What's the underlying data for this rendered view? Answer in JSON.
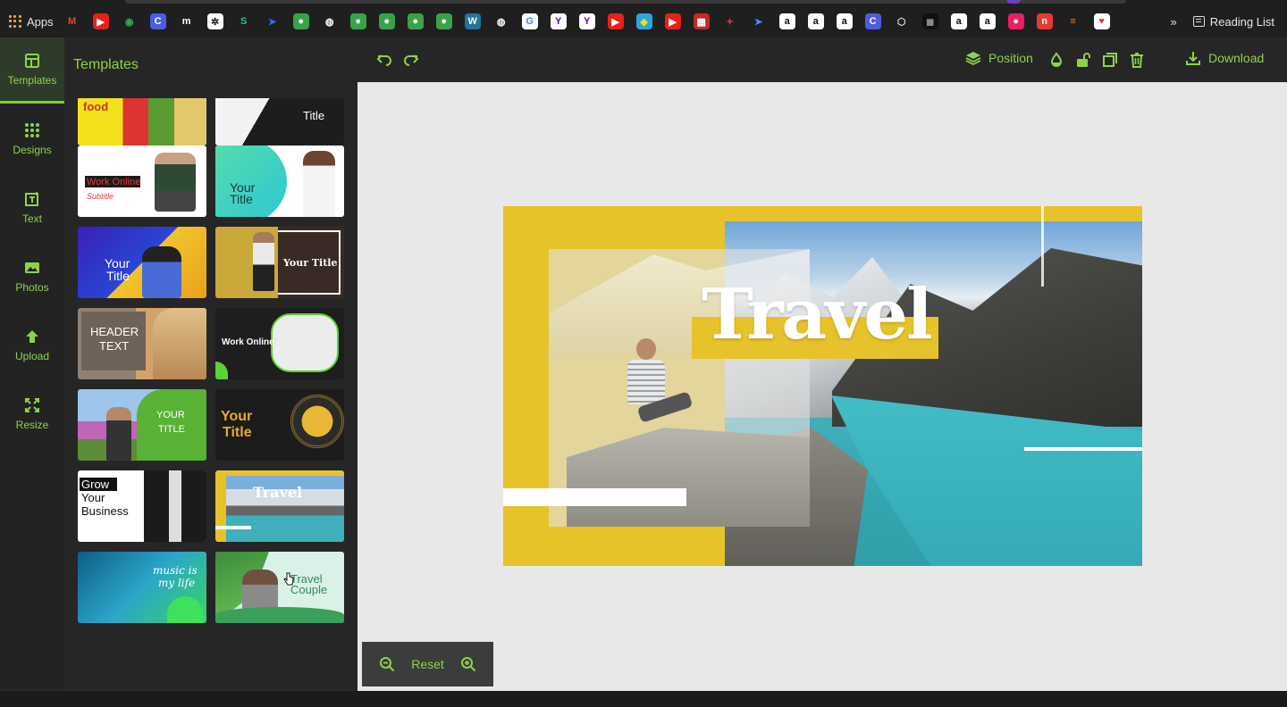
{
  "browser": {
    "apps_label": "Apps",
    "reading_list_label": "Reading List",
    "overflow_label": "»",
    "bookmarks": [
      {
        "name": "gmail-icon",
        "color": "#1f1f1f",
        "fg": "#ea4335",
        "glyph": "M"
      },
      {
        "name": "youtube-icon",
        "color": "#e62117",
        "fg": "#fff",
        "glyph": "▶"
      },
      {
        "name": "maps-icon",
        "color": "#1f1f1f",
        "fg": "#34a853",
        "glyph": "◉"
      },
      {
        "name": "c-icon",
        "color": "#4a5ce0",
        "fg": "#fff",
        "glyph": "C"
      },
      {
        "name": "m-icon",
        "color": "#1f1f1f",
        "fg": "#fff",
        "glyph": "m"
      },
      {
        "name": "openai-icon",
        "color": "#fff",
        "fg": "#111",
        "glyph": "✲"
      },
      {
        "name": "green-s-icon",
        "color": "#1f1f1f",
        "fg": "#19c39c",
        "glyph": "S"
      },
      {
        "name": "arrow-icon",
        "color": "#1f1f1f",
        "fg": "#3b6cff",
        "glyph": "➤"
      },
      {
        "name": "leaf-icon",
        "color": "#3aa14a",
        "fg": "#fff",
        "glyph": "●"
      },
      {
        "name": "globe-icon",
        "color": "#1f1f1f",
        "fg": "#fff",
        "glyph": "◍"
      },
      {
        "name": "leaf-icon",
        "color": "#3aa14a",
        "fg": "#fff",
        "glyph": "●"
      },
      {
        "name": "leaf-icon",
        "color": "#3aa14a",
        "fg": "#fff",
        "glyph": "●"
      },
      {
        "name": "leaf-icon",
        "color": "#3aa14a",
        "fg": "#fff",
        "glyph": "●"
      },
      {
        "name": "leaf-icon",
        "color": "#3aa14a",
        "fg": "#fff",
        "glyph": "●"
      },
      {
        "name": "wordpress-icon",
        "color": "#21759b",
        "fg": "#fff",
        "glyph": "W"
      },
      {
        "name": "globe-icon",
        "color": "#1f1f1f",
        "fg": "#fff",
        "glyph": "◍"
      },
      {
        "name": "google-icon",
        "color": "#fff",
        "fg": "#4285f4",
        "glyph": "G"
      },
      {
        "name": "yahoo-icon",
        "color": "#fff",
        "fg": "#5f01d1",
        "glyph": "Y"
      },
      {
        "name": "yahoo-icon",
        "color": "#fff",
        "fg": "#5f01d1",
        "glyph": "Y"
      },
      {
        "name": "youtube-icon",
        "color": "#e62117",
        "fg": "#fff",
        "glyph": "▶"
      },
      {
        "name": "colorful-icon",
        "color": "#2aa6e0",
        "fg": "#ffdd00",
        "glyph": "◆"
      },
      {
        "name": "youtube-icon",
        "color": "#e62117",
        "fg": "#fff",
        "glyph": "▶"
      },
      {
        "name": "red-grid-icon",
        "color": "#c62828",
        "fg": "#fff",
        "glyph": "▦"
      },
      {
        "name": "red-star-icon",
        "color": "#1f1f1f",
        "fg": "#d32f2f",
        "glyph": "✦"
      },
      {
        "name": "send-icon",
        "color": "#1f1f1f",
        "fg": "#4a8cff",
        "glyph": "➤"
      },
      {
        "name": "amazon-icon",
        "color": "#fff",
        "fg": "#111",
        "glyph": "a"
      },
      {
        "name": "amazon-icon",
        "color": "#fff",
        "fg": "#111",
        "glyph": "a"
      },
      {
        "name": "amazon-icon",
        "color": "#fff",
        "fg": "#111",
        "glyph": "a"
      },
      {
        "name": "c-icon",
        "color": "#4a5ce0",
        "fg": "#fff",
        "glyph": "C"
      },
      {
        "name": "cube-icon",
        "color": "#1f1f1f",
        "fg": "#ddd",
        "glyph": "⬡"
      },
      {
        "name": "dark-icon",
        "color": "#111",
        "fg": "#888",
        "glyph": "◼"
      },
      {
        "name": "amazon-icon",
        "color": "#fff",
        "fg": "#111",
        "glyph": "a"
      },
      {
        "name": "amazon-icon",
        "color": "#fff",
        "fg": "#111",
        "glyph": "a"
      },
      {
        "name": "pink-icon",
        "color": "#e91e63",
        "fg": "#fff",
        "glyph": "●"
      },
      {
        "name": "n-icon",
        "color": "#e53935",
        "fg": "#fff",
        "glyph": "n"
      },
      {
        "name": "stack-icon",
        "color": "#1f1f1f",
        "fg": "#f48024",
        "glyph": "≡"
      },
      {
        "name": "heart-icon",
        "color": "#fff",
        "fg": "#e53935",
        "glyph": "♥"
      }
    ]
  },
  "nav": {
    "items": [
      {
        "label": "Templates",
        "icon": "templates-icon",
        "active": true
      },
      {
        "label": "Designs",
        "icon": "designs-grid-icon",
        "active": false
      },
      {
        "label": "Text",
        "icon": "text-icon",
        "active": false
      },
      {
        "label": "Photos",
        "icon": "photo-icon",
        "active": false
      },
      {
        "label": "Upload",
        "icon": "upload-icon",
        "active": false
      },
      {
        "label": "Resize",
        "icon": "resize-icon",
        "active": false
      }
    ]
  },
  "panel": {
    "title": "Templates",
    "templates": [
      {
        "id": "food",
        "texts": [
          "food"
        ]
      },
      {
        "id": "title-dark",
        "texts": [
          "Title"
        ]
      },
      {
        "id": "work-online-white",
        "texts": [
          "Work Online",
          "Subtitle"
        ]
      },
      {
        "id": "your-title-teal",
        "texts": [
          "Your",
          "Title"
        ]
      },
      {
        "id": "your-title-vr",
        "texts": [
          "Your",
          "Title"
        ]
      },
      {
        "id": "your-title-olive",
        "texts": [
          "Your Title"
        ]
      },
      {
        "id": "header-text",
        "texts": [
          "HEADER",
          "TEXT"
        ]
      },
      {
        "id": "work-online-dark",
        "texts": [
          "Work Online"
        ]
      },
      {
        "id": "your-title-green",
        "texts": [
          "YOUR",
          "TITLE"
        ]
      },
      {
        "id": "your-title-gold",
        "texts": [
          "Your",
          "Title"
        ]
      },
      {
        "id": "grow-business",
        "texts": [
          "Grow",
          "Your",
          "Business"
        ]
      },
      {
        "id": "travel-selected",
        "texts": [
          "Travel"
        ]
      },
      {
        "id": "music-life",
        "texts": [
          "music is",
          "my life"
        ]
      },
      {
        "id": "travel-couple",
        "texts": [
          "Travel",
          "Couple"
        ]
      }
    ]
  },
  "toolbar": {
    "position_label": "Position",
    "download_label": "Download"
  },
  "design": {
    "title": "Travel",
    "colors": {
      "yellow": "#e6c32a",
      "lake": "#3fb0bb"
    }
  },
  "zoom": {
    "reset_label": "Reset"
  },
  "theme": {
    "accent": "#8fd14f",
    "panel_bg": "#262626",
    "stage_bg": "#e8e8e8"
  }
}
